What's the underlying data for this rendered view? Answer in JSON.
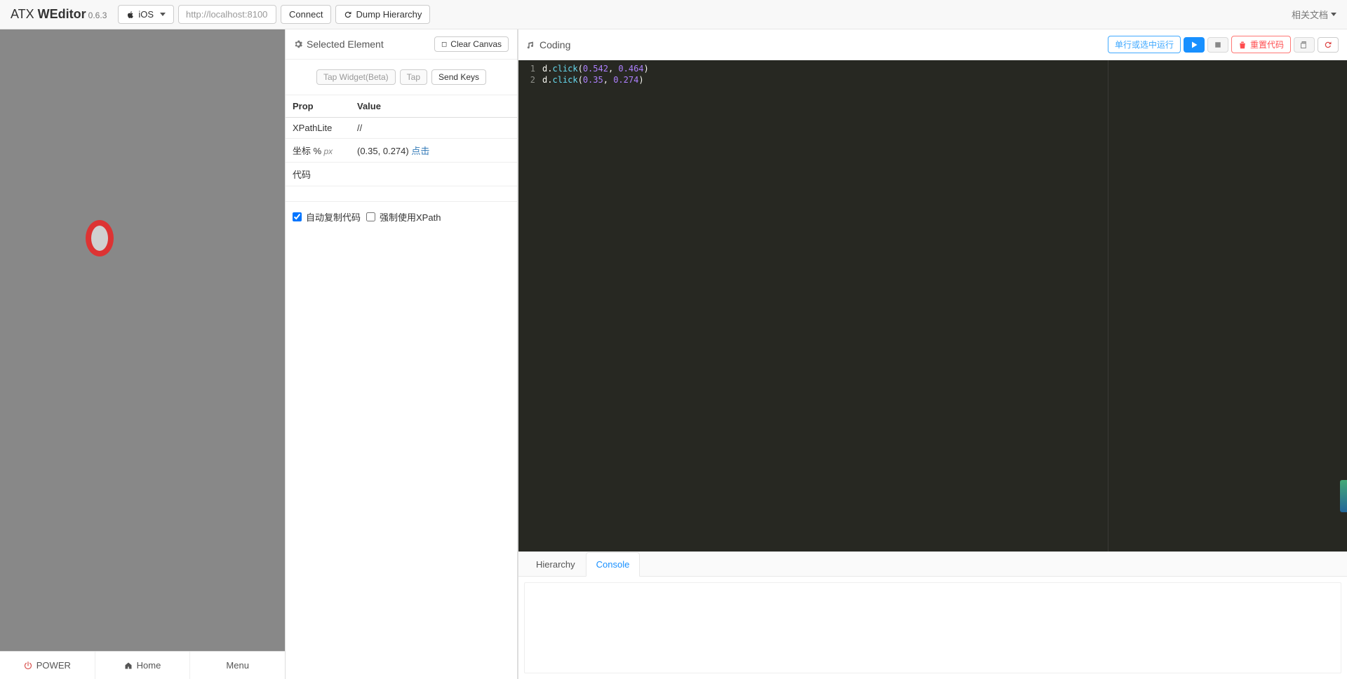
{
  "brand": {
    "prefix": "ATX ",
    "name": "WEditor",
    "version": "0.6.3"
  },
  "platform_selector": {
    "selected": "iOS"
  },
  "connect_input": {
    "placeholder": "http://localhost:8100",
    "value": ""
  },
  "toolbar": {
    "connect": "Connect",
    "dump_hierarchy": "Dump Hierarchy",
    "docs_link": "相关文档"
  },
  "device": {
    "tabs": {
      "power": "POWER",
      "home": "Home",
      "menu": "Menu"
    }
  },
  "middle": {
    "title": "Selected Element",
    "clear_canvas": "Clear Canvas",
    "actions": {
      "tap_widget": "Tap Widget(Beta)",
      "tap": "Tap",
      "send_keys": "Send Keys"
    },
    "table": {
      "header_prop": "Prop",
      "header_value": "Value",
      "rows": [
        {
          "prop": "XPathLite",
          "value": "//"
        },
        {
          "prop_main": "坐标 %",
          "prop_sub": " px",
          "value_text": "(0.35, 0.274) ",
          "value_link": "点击"
        },
        {
          "full_span": "代码"
        }
      ]
    },
    "checks": {
      "auto_copy": "自动复制代码",
      "force_xpath": "强制使用XPath",
      "auto_copy_checked": true,
      "force_xpath_checked": false
    }
  },
  "right": {
    "title": "Coding",
    "buttons": {
      "run": "单行或选中运行",
      "reset": "重置代码"
    },
    "code_lines": [
      {
        "n": "1",
        "raw": "d.click(0.542, 0.464)"
      },
      {
        "n": "2",
        "raw": "d.click(0.35, 0.274)"
      }
    ],
    "bottom_tabs": {
      "hierarchy": "Hierarchy",
      "console": "Console"
    }
  }
}
